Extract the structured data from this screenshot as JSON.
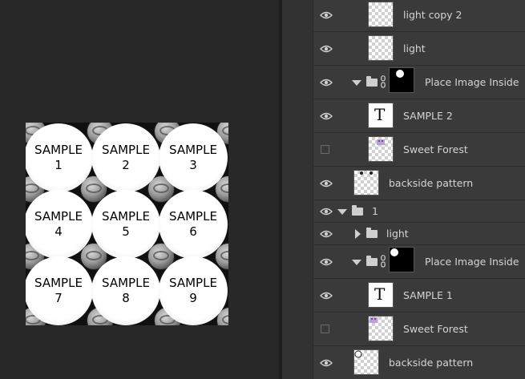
{
  "artwork": {
    "buttons": [
      {
        "line1": "SAMPLE",
        "line2": "1"
      },
      {
        "line1": "SAMPLE",
        "line2": "2"
      },
      {
        "line1": "SAMPLE",
        "line2": "3"
      },
      {
        "line1": "SAMPLE",
        "line2": "4"
      },
      {
        "line1": "SAMPLE",
        "line2": "5"
      },
      {
        "line1": "SAMPLE",
        "line2": "6"
      },
      {
        "line1": "SAMPLE",
        "line2": "7"
      },
      {
        "line1": "SAMPLE",
        "line2": "8"
      },
      {
        "line1": "SAMPLE",
        "line2": "9"
      }
    ]
  },
  "layers": {
    "items": [
      {
        "name": "light copy 2",
        "visible": true
      },
      {
        "name": "light",
        "visible": true
      },
      {
        "name": "Place Image Inside",
        "visible": true
      },
      {
        "name": "SAMPLE 2",
        "visible": true
      },
      {
        "name": "Sweet Forest",
        "visible": false
      },
      {
        "name": "backside pattern",
        "visible": true
      },
      {
        "name": "1",
        "visible": true
      },
      {
        "name": "light",
        "visible": true
      },
      {
        "name": "Place Image Inside",
        "visible": true
      },
      {
        "name": "SAMPLE 1",
        "visible": true
      },
      {
        "name": "Sweet Forest",
        "visible": false
      },
      {
        "name": "backside pattern",
        "visible": true
      }
    ]
  },
  "icons": {
    "visibility": "eye-icon",
    "group": "folder-icon",
    "link": "chain-link-icon",
    "text_layer": "text-layer-icon",
    "expand": "triangle-down-icon",
    "collapse": "triangle-right-icon"
  }
}
